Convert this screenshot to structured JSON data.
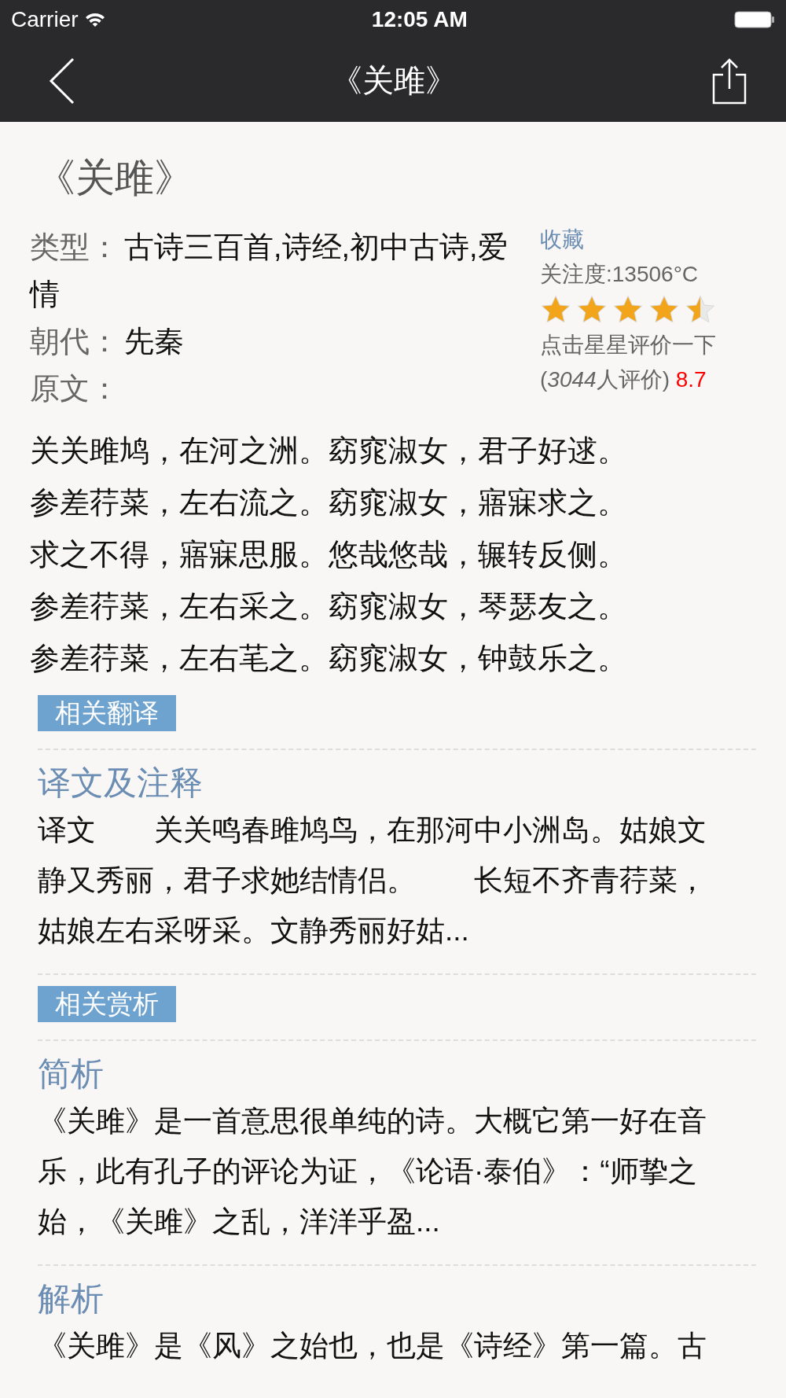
{
  "status_bar": {
    "carrier": "Carrier",
    "time": "12:05 AM"
  },
  "nav_bar": {
    "title": "《关雎》"
  },
  "poem": {
    "title": "《关雎》",
    "meta": [
      {
        "label": "类型：",
        "value": "古诗三百首,诗经,初中古诗,爱情"
      },
      {
        "label": "朝代：",
        "value": "先秦"
      },
      {
        "label": "原文："
      }
    ],
    "favorite": "收藏",
    "popularity": "关注度:13506°C",
    "stars": 4.5,
    "rate_hint": "点击星星评价一下",
    "rating": {
      "open": "(",
      "count": "3044",
      "close": "人评价)"
    },
    "score": "8.7",
    "lines": [
      "关关雎鸠，在河之洲。窈窕淑女，君子好逑。",
      "参差荇菜，左右流之。窈窕淑女，寤寐求之。",
      "求之不得，寤寐思服。悠哉悠哉，辗转反侧。",
      "参差荇菜，左右采之。窈窕淑女，琴瑟友之。",
      "参差荇菜，左右芼之。窈窕淑女，钟鼓乐之。"
    ]
  },
  "sections": [
    {
      "tag": "相关翻译",
      "articles": [
        {
          "heading": "译文及注释",
          "lines": [
            "译文　　关关鸣春雎鸠鸟，在那河中小洲岛。姑娘文",
            "静又秀丽，君子求她结情侣。　　长短不齐青荇菜，",
            "姑娘左右采呀采。文静秀丽好姑..."
          ]
        }
      ]
    },
    {
      "tag": "相关赏析",
      "articles": [
        {
          "heading": "简析",
          "lines": [
            "《关雎》是一首意思很单纯的诗。大概它第一好在音",
            "乐，此有孔子的评论为证，《论语·泰伯》：“师挚之",
            "始，《关雎》之乱，洋洋乎盈..."
          ]
        },
        {
          "heading": "解析",
          "lines": [
            "《关雎》是《风》之始也，也是《诗经》第一篇。古"
          ]
        }
      ]
    }
  ]
}
